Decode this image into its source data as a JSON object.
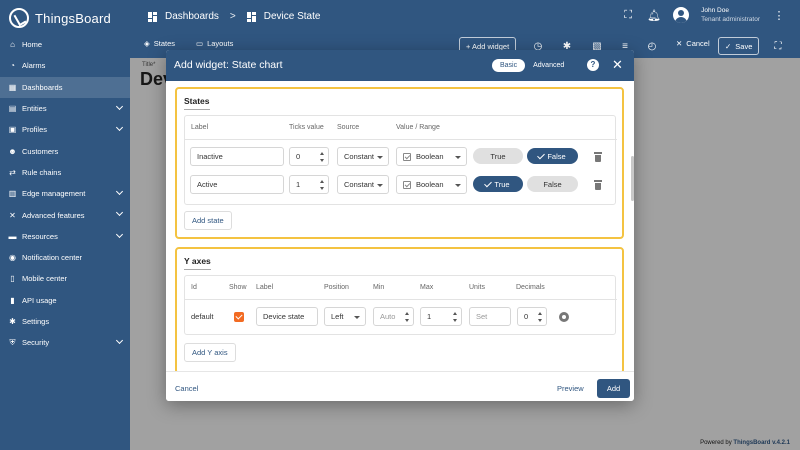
{
  "app": {
    "name": "ThingsBoard"
  },
  "breadcrumb": {
    "root": "Dashboards",
    "current": "Device State"
  },
  "user": {
    "name": "John Doe",
    "role": "Tenant administrator"
  },
  "sidebar": {
    "items": [
      {
        "label": "Home",
        "icon": "home-icon",
        "glyph": "⌂",
        "expandable": false,
        "active": false
      },
      {
        "label": "Alarms",
        "icon": "alarm-icon",
        "glyph": "◔",
        "expandable": false,
        "active": false
      },
      {
        "label": "Dashboards",
        "icon": "dashboard-icon",
        "glyph": "▦",
        "expandable": false,
        "active": true
      },
      {
        "label": "Entities",
        "icon": "entities-icon",
        "glyph": "▤",
        "expandable": true,
        "active": false
      },
      {
        "label": "Profiles",
        "icon": "profiles-icon",
        "glyph": "▣",
        "expandable": true,
        "active": false
      },
      {
        "label": "Customers",
        "icon": "customers-icon",
        "glyph": "☻",
        "expandable": false,
        "active": false
      },
      {
        "label": "Rule chains",
        "icon": "rule-chains-icon",
        "glyph": "⇄",
        "expandable": false,
        "active": false
      },
      {
        "label": "Edge management",
        "icon": "edge-icon",
        "glyph": "▥",
        "expandable": true,
        "active": false
      },
      {
        "label": "Advanced features",
        "icon": "advanced-features-icon",
        "glyph": "✕",
        "expandable": true,
        "active": false
      },
      {
        "label": "Resources",
        "icon": "resources-icon",
        "glyph": "▬",
        "expandable": true,
        "active": false
      },
      {
        "label": "Notification center",
        "icon": "notification-center-icon",
        "glyph": "◉",
        "expandable": false,
        "active": false
      },
      {
        "label": "Mobile center",
        "icon": "mobile-center-icon",
        "glyph": "▯",
        "expandable": false,
        "active": false
      },
      {
        "label": "API usage",
        "icon": "api-usage-icon",
        "glyph": "▮",
        "expandable": false,
        "active": false
      },
      {
        "label": "Settings",
        "icon": "settings-icon",
        "glyph": "✱",
        "expandable": false,
        "active": false
      },
      {
        "label": "Security",
        "icon": "security-icon",
        "glyph": "⛨",
        "expandable": true,
        "active": false
      }
    ]
  },
  "toolbar": {
    "states_label": "States",
    "layouts_label": "Layouts",
    "add_widget_label": "+ Add widget",
    "cancel_label": "Cancel",
    "save_label": "Save"
  },
  "dashboard": {
    "title_label": "Title*",
    "title_fragment": "Dev"
  },
  "dialog": {
    "title": "Add widget:  State chart",
    "mode_basic": "Basic",
    "mode_advanced": "Advanced",
    "help": "?",
    "states": {
      "title": "States",
      "columns": [
        "Label",
        "Ticks value",
        "Source",
        "Value / Range"
      ],
      "rows": [
        {
          "label": "Inactive",
          "ticks": "0",
          "source": "Constant",
          "type": "Boolean",
          "true_label": "True",
          "false_label": "False",
          "selected": "false"
        },
        {
          "label": "Active",
          "ticks": "1",
          "source": "Constant",
          "type": "Boolean",
          "true_label": "True",
          "false_label": "False",
          "selected": "true"
        }
      ],
      "add_label": "Add state"
    },
    "yaxes": {
      "title": "Y axes",
      "columns": [
        "Id",
        "Show",
        "Label",
        "Position",
        "Min",
        "Max",
        "Units",
        "Decimals"
      ],
      "row": {
        "id": "default",
        "show": true,
        "label": "Device state",
        "position": "Left",
        "min_placeholder": "Auto",
        "max": "1",
        "units_placeholder": "Set",
        "decimals": "0"
      },
      "add_label": "Add Y axis"
    },
    "footer": {
      "cancel": "Cancel",
      "preview": "Preview",
      "add": "Add"
    }
  },
  "footer": {
    "powered_prefix": "Powered by ",
    "powered_brand": "ThingsBoard v.4.2.1"
  },
  "colors": {
    "primary": "#305680",
    "highlight": "#f4c341",
    "checkbox": "#f26b23"
  }
}
